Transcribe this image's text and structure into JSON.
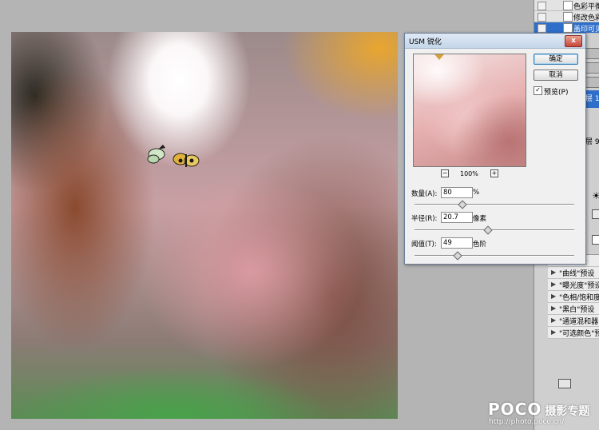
{
  "history": {
    "items": [
      {
        "label": "色彩平衡"
      },
      {
        "label": "修改色彩"
      },
      {
        "label": "盖印可见"
      }
    ]
  },
  "layers": {
    "fragments": [
      "层 10",
      "层 9"
    ]
  },
  "adjustments": {
    "presets": [
      "设",
      "\"曲线\"预设",
      "\"曝光度\"预设",
      "\"色相/饱和度\"",
      "\"黑白\"预设",
      "\"通道混和器\"",
      "\"可选颜色\"预设"
    ]
  },
  "dialog": {
    "title": "USM 锐化",
    "close_label": "x",
    "ok_label": "确定",
    "cancel_label": "取消",
    "preview_label": "预览(P)",
    "preview_checked": true,
    "zoom_out": "−",
    "zoom_in": "+",
    "zoom_level": "100%",
    "params": [
      {
        "label": "数量(A):",
        "value": "80",
        "unit": "%",
        "slider_fraction": 0.3
      },
      {
        "label": "半径(R):",
        "value": "20.7",
        "unit": "像素",
        "slider_fraction": 0.46
      },
      {
        "label": "阈值(T):",
        "value": "49",
        "unit": "色阶",
        "slider_fraction": 0.27
      }
    ]
  },
  "watermark": {
    "brand": "POCO",
    "subtitle": "摄影专题",
    "url": "http://photo.poco.cn/"
  }
}
